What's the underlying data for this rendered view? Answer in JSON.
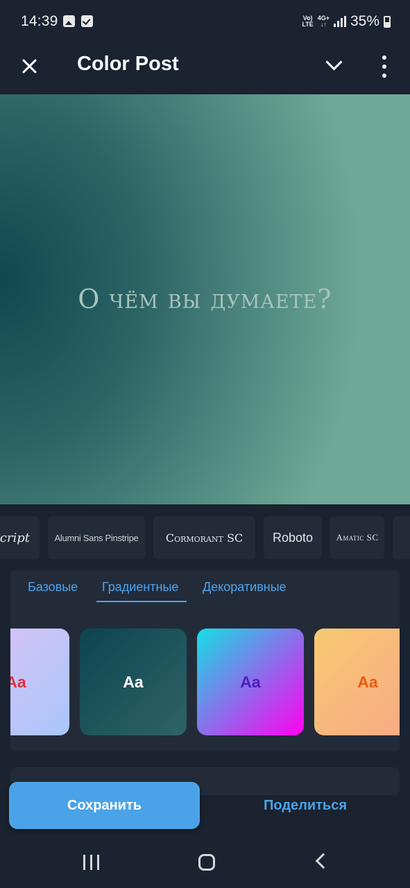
{
  "status_bar": {
    "time": "14:39",
    "network_label_top": "Vo)",
    "network_label_bottom": "LTE",
    "data_label_top": "4G+",
    "data_label_bottom": "↓↑",
    "battery": "35%"
  },
  "app_bar": {
    "title": "Color Post"
  },
  "canvas": {
    "text": "О чём вы думаете?",
    "gradient_colors": [
      "#0e4850",
      "#6ea896"
    ]
  },
  "fonts": [
    {
      "label": "cript"
    },
    {
      "label": "Alumni Sans Pinstripe"
    },
    {
      "label": "Cormorant SC"
    },
    {
      "label": "Roboto"
    },
    {
      "label": "Amatic SC"
    }
  ],
  "palette": {
    "tabs": [
      {
        "label": "Базовые"
      },
      {
        "label": "Градиентные"
      },
      {
        "label": "Декоративные"
      }
    ],
    "active_tab": "Градиентные",
    "swatch_label": "Aa",
    "swatches": [
      {
        "label": "Aa",
        "colors": [
          "#dfc3f5",
          "#a9c6fc"
        ],
        "text_color": "#e0323c"
      },
      {
        "label": "Aa",
        "colors": [
          "#0d4451",
          "#2e6466"
        ],
        "text_color": "#ffffff"
      },
      {
        "label": "Aa",
        "colors": [
          "#14e0e6",
          "#ff00f0"
        ],
        "text_color": "#4b1fb8"
      },
      {
        "label": "Aa",
        "colors": [
          "#f7ca73",
          "#f9a786"
        ],
        "text_color": "#e55e14"
      }
    ]
  },
  "actions": {
    "save_label": "Сохранить",
    "share_label": "Поделиться"
  },
  "colors": {
    "background": "#1b2230",
    "panel": "#232b39",
    "accent": "#4aa3e6"
  }
}
